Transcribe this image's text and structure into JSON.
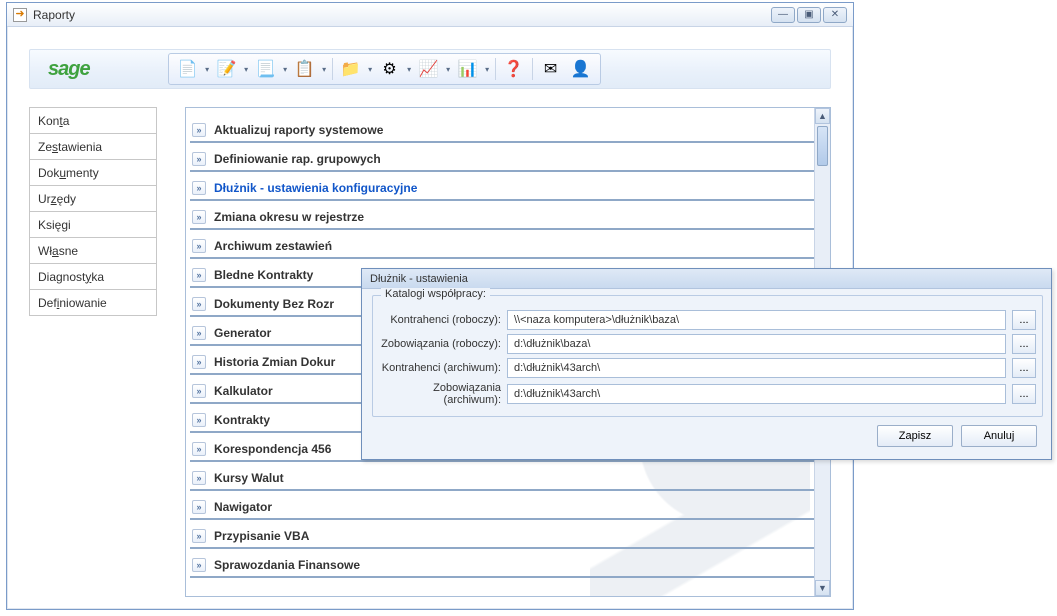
{
  "window": {
    "title": "Raporty"
  },
  "winbtns": {
    "min": "—",
    "max": "▣",
    "close": "✕"
  },
  "logo": "sage",
  "toolbar": [
    {
      "name": "doc-icon",
      "glyph": "📄"
    },
    {
      "name": "settings-doc-icon",
      "glyph": "📝"
    },
    {
      "name": "vat-icon",
      "glyph": "📃"
    },
    {
      "name": "doc-alert-icon",
      "glyph": "📋"
    },
    {
      "name": "folder-icon",
      "glyph": "📁"
    },
    {
      "name": "gears-icon",
      "glyph": "⚙"
    },
    {
      "name": "chart-icon",
      "glyph": "📈"
    },
    {
      "name": "pit-icon",
      "glyph": "📊"
    },
    {
      "name": "help-icon",
      "glyph": "❓"
    },
    {
      "name": "mail-icon",
      "glyph": "✉"
    },
    {
      "name": "user-icon",
      "glyph": "👤"
    }
  ],
  "sidebar": [
    {
      "pre": "Kon",
      "u": "t",
      "post": "a"
    },
    {
      "pre": "Ze",
      "u": "s",
      "post": "tawienia"
    },
    {
      "pre": "Dok",
      "u": "u",
      "post": "menty"
    },
    {
      "pre": "Ur",
      "u": "z",
      "post": "ędy"
    },
    {
      "pre": "Księ",
      "u": "g",
      "post": "i"
    },
    {
      "pre": "Wł",
      "u": "a",
      "post": "sne"
    },
    {
      "pre": "Diagnost",
      "u": "y",
      "post": "ka"
    },
    {
      "pre": "Def",
      "u": "i",
      "post": "niowanie"
    }
  ],
  "reports": [
    {
      "label": "Aktualizuj raporty systemowe"
    },
    {
      "label": "Definiowanie rap. grupowych"
    },
    {
      "label": "Dłużnik - ustawienia konfiguracyjne",
      "selected": true
    },
    {
      "label": "Zmiana okresu w rejestrze"
    },
    {
      "label": "Archiwum zestawień"
    },
    {
      "label": "Bledne Kontrakty"
    },
    {
      "label": "Dokumenty Bez Rozr"
    },
    {
      "label": "Generator"
    },
    {
      "label": "Historia Zmian Dokur"
    },
    {
      "label": "Kalkulator"
    },
    {
      "label": "Kontrakty"
    },
    {
      "label": "Korespondencja 456"
    },
    {
      "label": "Kursy Walut"
    },
    {
      "label": "Nawigator"
    },
    {
      "label": "Przypisanie VBA"
    },
    {
      "label": "Sprawozdania Finansowe"
    }
  ],
  "dialog": {
    "title": "Dłużnik - ustawienia",
    "group": "Katalogi współpracy:",
    "fields": [
      {
        "label": "Kontrahenci (roboczy):",
        "value": "\\\\<naza komputera>\\dłużnik\\baza\\"
      },
      {
        "label": "Zobowiązania (roboczy):",
        "value": "d:\\dłużnik\\baza\\"
      },
      {
        "label": "Kontrahenci (archiwum):",
        "value": "d:\\dłużnik\\43arch\\"
      },
      {
        "label": "Zobowiązania (archiwum):",
        "value": "d:\\dłużnik\\43arch\\"
      }
    ],
    "browse": "...",
    "save": "Zapisz",
    "cancel": "Anuluj"
  }
}
